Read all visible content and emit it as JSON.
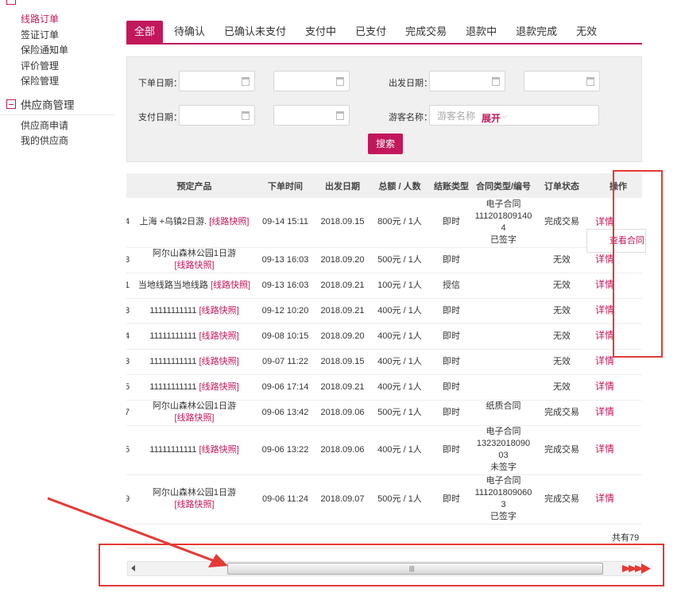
{
  "sidebar": {
    "group1_items": [
      "线路订单",
      "签证订单",
      "保险通知单",
      "评价管理",
      "保险管理"
    ],
    "group2_title": "供应商管理",
    "group2_items": [
      "供应商申请",
      "我的供应商"
    ]
  },
  "tabs": [
    "全部",
    "待确认",
    "已确认未支付",
    "支付中",
    "已支付",
    "完成交易",
    "退款中",
    "退款完成",
    "无效"
  ],
  "filter": {
    "order_date_label": "下单日期：",
    "depart_date_label": "出发日期：",
    "pay_date_label": "支付日期：",
    "tourist_label": "游客名称：",
    "tourist_placeholder": "游客名称",
    "expand": "展开",
    "search": "搜索"
  },
  "table": {
    "headers": [
      "预定产品",
      "下单时间",
      "出发日期",
      "总额 / 人数",
      "结账类型",
      "合同类型/编号",
      "订单状态",
      "操作"
    ],
    "rows": [
      {
        "id_tail": "4",
        "product": "上海 +乌镇2日游.",
        "snapshot": "[线路快照]",
        "order_time": "09-14 15:11",
        "depart": "2018.09.15",
        "total": "800元 / 1人",
        "settle": "即时",
        "contract": [
          "电子合同",
          "111201809140",
          "4",
          "已签字"
        ],
        "status": "完成交易",
        "action": "详情"
      },
      {
        "id_tail": "3",
        "product": "阿尔山森林公园1日游",
        "snapshot": "[线路快照]",
        "order_time": "09-13 16:03",
        "depart": "2018.09.20",
        "total": "500元 / 1人",
        "settle": "即时",
        "contract": [],
        "status": "无效",
        "action": "详情"
      },
      {
        "id_tail": "1",
        "product": "当地线路当地线路",
        "snapshot": "[线路快照]",
        "order_time": "09-13 16:03",
        "depart": "2018.09.21",
        "total": "100元 / 1人",
        "settle": "授信",
        "contract": [],
        "status": "无效",
        "action": "详情"
      },
      {
        "id_tail": "3",
        "product": "11111111111",
        "snapshot": "[线路快照]",
        "order_time": "09-12 10:20",
        "depart": "2018.09.21",
        "total": "400元 / 1人",
        "settle": "即时",
        "contract": [],
        "status": "无效",
        "action": "详情"
      },
      {
        "id_tail": "4",
        "product": "11111111111",
        "snapshot": "[线路快照]",
        "order_time": "09-08 10:15",
        "depart": "2018.09.20",
        "total": "400元 / 1人",
        "settle": "即时",
        "contract": [],
        "status": "无效",
        "action": "详情"
      },
      {
        "id_tail": "3",
        "product": "11111111111",
        "snapshot": "[线路快照]",
        "order_time": "09-07 11:22",
        "depart": "2018.09.15",
        "total": "400元 / 1人",
        "settle": "即时",
        "contract": [],
        "status": "无效",
        "action": "详情"
      },
      {
        "id_tail": "5",
        "product": "11111111111",
        "snapshot": "[线路快照]",
        "order_time": "09-06 17:14",
        "depart": "2018.09.21",
        "total": "400元 / 1人",
        "settle": "即时",
        "contract": [],
        "status": "无效",
        "action": "详情"
      },
      {
        "id_tail": "7",
        "product": "阿尔山森林公园1日游",
        "snapshot": "[线路快照]",
        "order_time": "09-06 13:42",
        "depart": "2018.09.06",
        "total": "500元 / 1人",
        "settle": "即时",
        "contract": [
          "纸质合同"
        ],
        "status": "完成交易",
        "action": "详情"
      },
      {
        "id_tail": "5",
        "product": "11111111111",
        "snapshot": "[线路快照]",
        "order_time": "09-06 13:22",
        "depart": "2018.09.06",
        "total": "400元 / 1人",
        "settle": "即时",
        "contract": [
          "电子合同",
          "13232018090",
          "03",
          "未签字"
        ],
        "status": "完成交易",
        "action": "详情"
      },
      {
        "id_tail": "9",
        "product": "阿尔山森林公园1日游",
        "snapshot": "[线路快照]",
        "order_time": "09-06 11:24",
        "depart": "2018.09.07",
        "total": "500元 / 1人",
        "settle": "即时",
        "contract": [
          "电子合同",
          "111201809060",
          "3",
          "已签字"
        ],
        "status": "完成交易",
        "action": "详情"
      }
    ],
    "popup_text": "查看合同",
    "total_text": "共有79"
  },
  "colors": {
    "accent": "#c2185b",
    "annotation": "#e53935"
  }
}
